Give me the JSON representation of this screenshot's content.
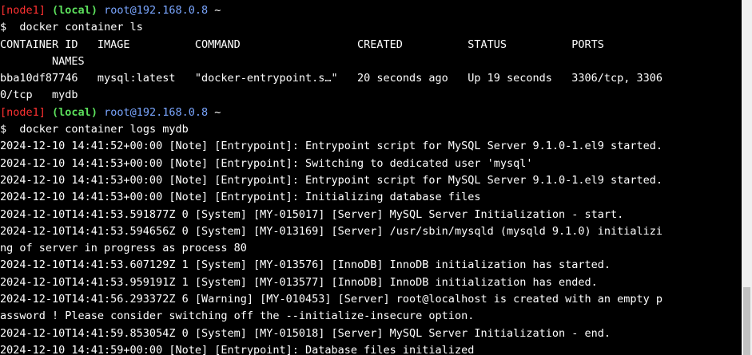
{
  "prompt1": {
    "host": "[node1]",
    "env": "(local)",
    "user": "root@192.168.0.8",
    "path": "~",
    "symbol": "$",
    "command": "docker container ls"
  },
  "container_ls_output": [
    "CONTAINER ID   IMAGE          COMMAND                  CREATED          STATUS          PORTS",
    "        NAMES",
    "bba10df87746   mysql:latest   \"docker-entrypoint.s…\"   20 seconds ago   Up 19 seconds   3306/tcp, 3306",
    "0/tcp   mydb"
  ],
  "prompt2": {
    "host": "[node1]",
    "env": "(local)",
    "user": "root@192.168.0.8",
    "path": "~",
    "symbol": "$",
    "command": "docker container logs mydb"
  },
  "logs_output": [
    "2024-12-10 14:41:52+00:00 [Note] [Entrypoint]: Entrypoint script for MySQL Server 9.1.0-1.el9 started.",
    "2024-12-10 14:41:53+00:00 [Note] [Entrypoint]: Switching to dedicated user 'mysql'",
    "2024-12-10 14:41:53+00:00 [Note] [Entrypoint]: Entrypoint script for MySQL Server 9.1.0-1.el9 started.",
    "2024-12-10 14:41:53+00:00 [Note] [Entrypoint]: Initializing database files",
    "2024-12-10T14:41:53.591877Z 0 [System] [MY-015017] [Server] MySQL Server Initialization - start.",
    "2024-12-10T14:41:53.594656Z 0 [System] [MY-013169] [Server] /usr/sbin/mysqld (mysqld 9.1.0) initializi",
    "ng of server in progress as process 80",
    "2024-12-10T14:41:53.607129Z 1 [System] [MY-013576] [InnoDB] InnoDB initialization has started.",
    "2024-12-10T14:41:53.959191Z 1 [System] [MY-013577] [InnoDB] InnoDB initialization has ended.",
    "2024-12-10T14:41:56.293372Z 6 [Warning] [MY-010453] [Server] root@localhost is created with an empty p",
    "assword ! Please consider switching off the --initialize-insecure option.",
    "2024-12-10T14:41:59.853054Z 0 [System] [MY-015018] [Server] MySQL Server Initialization - end.",
    "2024-12-10 14:41:59+00:00 [Note] [Entrypoint]: Database files initialized"
  ]
}
